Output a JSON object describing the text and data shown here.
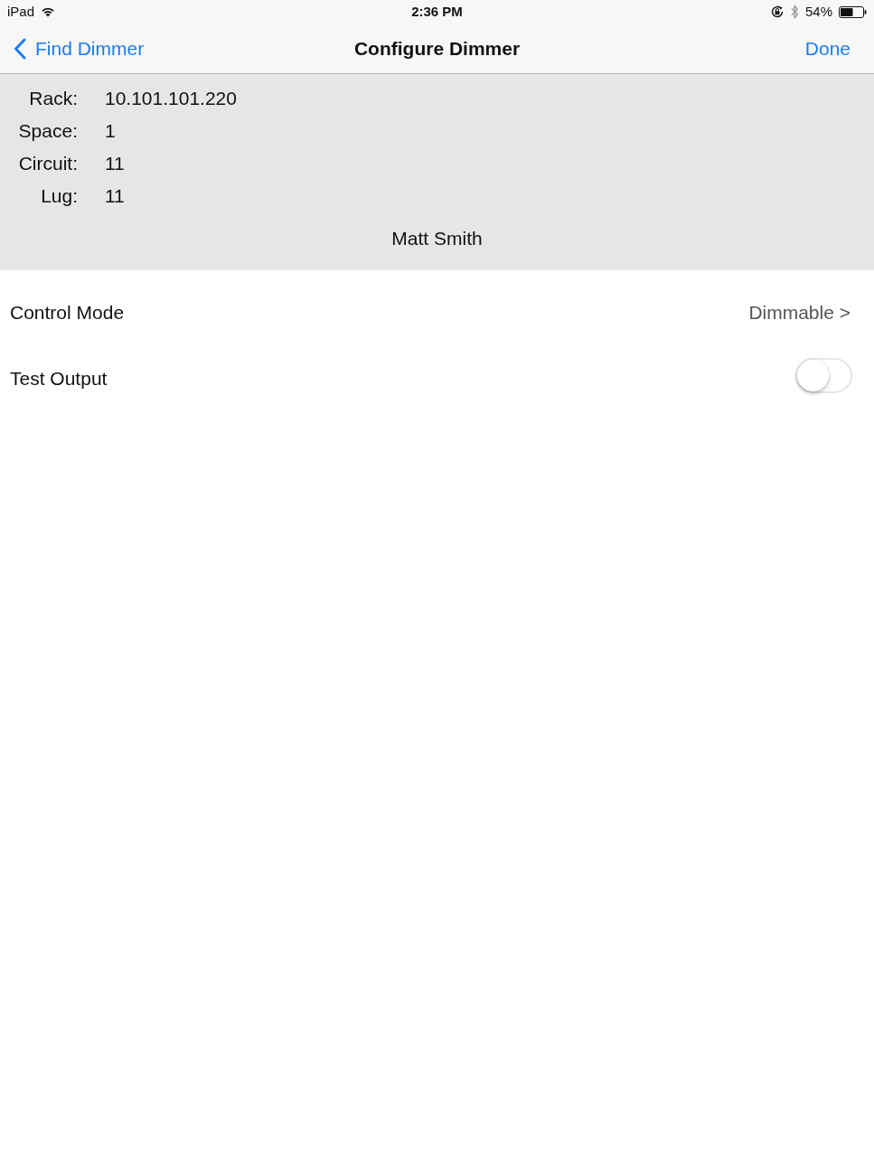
{
  "status_bar": {
    "device": "iPad",
    "time": "2:36 PM",
    "battery_text": "54%"
  },
  "nav_bar": {
    "back": "Find Dimmer",
    "title": "Configure Dimmer",
    "action": "Done"
  },
  "info": {
    "fields": [
      {
        "label": "Rack:",
        "value": "10.101.101.220"
      },
      {
        "label": "Space:",
        "value": "1"
      },
      {
        "label": "Circuit:",
        "value": "11"
      },
      {
        "label": "Lug:",
        "value": "11"
      }
    ],
    "name": "Matt Smith"
  },
  "settings": [
    {
      "kind": "disclosure",
      "label": "Control Mode",
      "value": "Dimmable >"
    },
    {
      "kind": "toggle",
      "label": "Test Output",
      "on": false
    }
  ]
}
